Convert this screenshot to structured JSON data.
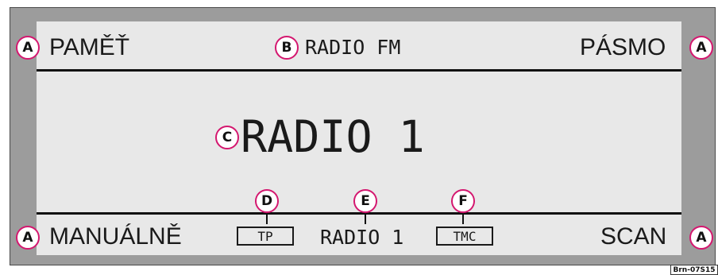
{
  "display": {
    "top_left": "PAMĚŤ",
    "top_center": "RADIO FM",
    "top_right": "PÁSMO",
    "main": "RADIO 1",
    "bottom_left": "MANUÁLNĚ",
    "bottom_center": "RADIO 1",
    "bottom_right": "SCAN",
    "tp_indicator": "TP",
    "tmc_indicator": "TMC"
  },
  "callouts": {
    "a": "A",
    "b": "B",
    "c": "C",
    "d": "D",
    "e": "E",
    "f": "F"
  },
  "reference_code": "Brn-07S15",
  "colors": {
    "callout_border": "#d4176f",
    "frame": "#9c9c9c",
    "screen": "#e8e8e8"
  }
}
